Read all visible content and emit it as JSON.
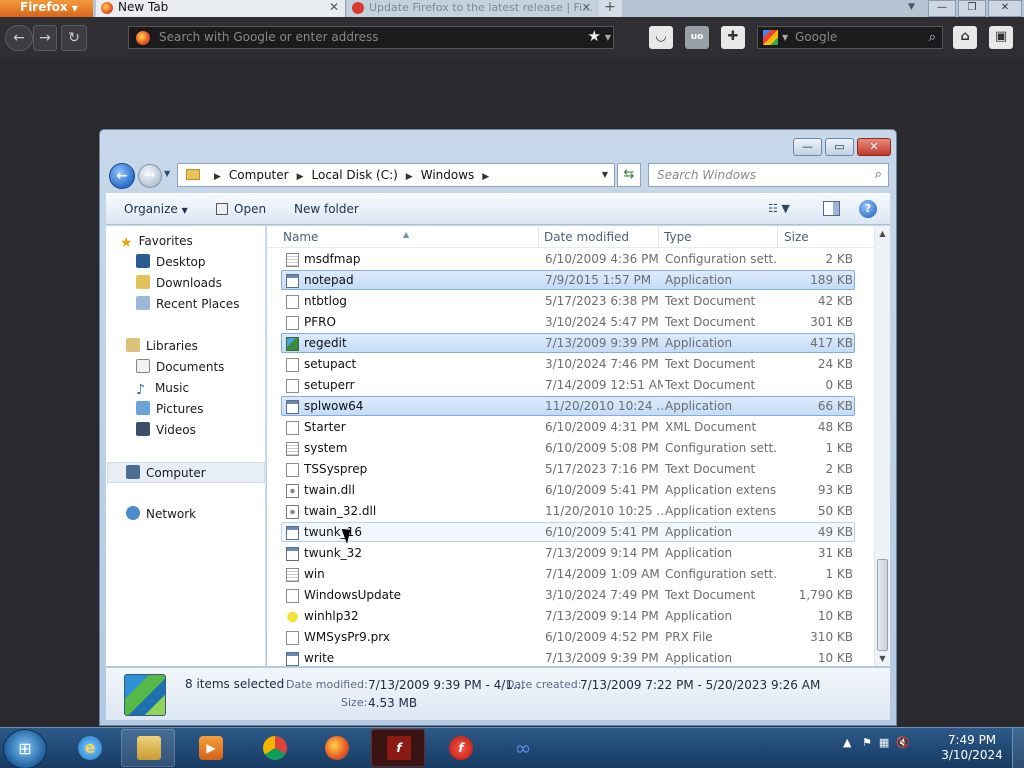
{
  "browser": {
    "menu_label": "Firefox",
    "tabs": [
      {
        "title": "New Tab"
      },
      {
        "title": "Update Firefox to the latest release | Fi..."
      }
    ],
    "new_tab_symbol": "+",
    "urlbar_placeholder": "Search with Google or enter address",
    "search_placeholder": "Google",
    "icons": [
      "back-icon",
      "forward-icon",
      "reload-icon",
      "bookmark-star-icon",
      "pocket-icon",
      "ublock-icon",
      "addon-icon",
      "google-icon",
      "home-icon",
      "sidebar-icon"
    ]
  },
  "explorer": {
    "breadcrumb": [
      "Computer",
      "Local Disk (C:)",
      "Windows"
    ],
    "search_placeholder": "Search Windows",
    "toolbar": {
      "organize": "Organize",
      "open": "Open",
      "new_folder": "New folder"
    },
    "nav": {
      "favorites": "Favorites",
      "favorites_items": [
        "Desktop",
        "Downloads",
        "Recent Places"
      ],
      "libraries": "Libraries",
      "libraries_items": [
        "Documents",
        "Music",
        "Pictures",
        "Videos"
      ],
      "computer": "Computer",
      "network": "Network"
    },
    "columns": {
      "name": "Name",
      "date": "Date modified",
      "type": "Type",
      "size": "Size"
    },
    "files": [
      {
        "name": "msdfmap",
        "date": "6/10/2009 4:36 PM",
        "type": "Configuration sett...",
        "size": "2 KB",
        "icon": "cfg",
        "state": ""
      },
      {
        "name": "notepad",
        "date": "7/9/2015 1:57 PM",
        "type": "Application",
        "size": "189 KB",
        "icon": "app",
        "state": "sel"
      },
      {
        "name": "ntbtlog",
        "date": "5/17/2023 6:38 PM",
        "type": "Text Document",
        "size": "42 KB",
        "icon": "doc",
        "state": ""
      },
      {
        "name": "PFRO",
        "date": "3/10/2024 5:47 PM",
        "type": "Text Document",
        "size": "301 KB",
        "icon": "doc",
        "state": ""
      },
      {
        "name": "regedit",
        "date": "7/13/2009 9:39 PM",
        "type": "Application",
        "size": "417 KB",
        "icon": "reg",
        "state": "sel"
      },
      {
        "name": "setupact",
        "date": "3/10/2024 7:46 PM",
        "type": "Text Document",
        "size": "24 KB",
        "icon": "doc",
        "state": ""
      },
      {
        "name": "setuperr",
        "date": "7/14/2009 12:51 AM",
        "type": "Text Document",
        "size": "0 KB",
        "icon": "doc",
        "state": ""
      },
      {
        "name": "splwow64",
        "date": "11/20/2010 10:24 ...",
        "type": "Application",
        "size": "66 KB",
        "icon": "app",
        "state": "sel"
      },
      {
        "name": "Starter",
        "date": "6/10/2009 4:31 PM",
        "type": "XML Document",
        "size": "48 KB",
        "icon": "doc",
        "state": ""
      },
      {
        "name": "system",
        "date": "6/10/2009 5:08 PM",
        "type": "Configuration sett...",
        "size": "1 KB",
        "icon": "cfg",
        "state": ""
      },
      {
        "name": "TSSysprep",
        "date": "5/17/2023 7:16 PM",
        "type": "Text Document",
        "size": "2 KB",
        "icon": "doc",
        "state": ""
      },
      {
        "name": "twain.dll",
        "date": "6/10/2009 5:41 PM",
        "type": "Application extens...",
        "size": "93 KB",
        "icon": "dll",
        "state": ""
      },
      {
        "name": "twain_32.dll",
        "date": "11/20/2010 10:25 ...",
        "type": "Application extens...",
        "size": "50 KB",
        "icon": "dll",
        "state": ""
      },
      {
        "name": "twunk_16",
        "date": "6/10/2009 5:41 PM",
        "type": "Application",
        "size": "49 KB",
        "icon": "app",
        "state": "hov"
      },
      {
        "name": "twunk_32",
        "date": "7/13/2009 9:14 PM",
        "type": "Application",
        "size": "31 KB",
        "icon": "app",
        "state": ""
      },
      {
        "name": "win",
        "date": "7/14/2009 1:09 AM",
        "type": "Configuration sett...",
        "size": "1 KB",
        "icon": "cfg",
        "state": ""
      },
      {
        "name": "WindowsUpdate",
        "date": "3/10/2024 7:49 PM",
        "type": "Text Document",
        "size": "1,790 KB",
        "icon": "doc",
        "state": ""
      },
      {
        "name": "winhlp32",
        "date": "7/13/2009 9:14 PM",
        "type": "Application",
        "size": "10 KB",
        "icon": "help",
        "state": ""
      },
      {
        "name": "WMSysPr9.prx",
        "date": "6/10/2009 4:52 PM",
        "type": "PRX File",
        "size": "310 KB",
        "icon": "doc",
        "state": ""
      },
      {
        "name": "write",
        "date": "7/13/2009 9:39 PM",
        "type": "Application",
        "size": "10 KB",
        "icon": "app",
        "state": ""
      }
    ],
    "details": {
      "selected_count": "8 items selected",
      "date_modified_label": "Date modified:",
      "date_modified_value": "7/13/2009 9:39 PM - 4/1...",
      "date_created_label": "Date created:",
      "date_created_value": "7/13/2009 7:22 PM - 5/20/2023 9:26 AM",
      "size_label": "Size:",
      "size_value": "4.53 MB"
    }
  },
  "taskbar": {
    "apps": [
      "internet-explorer-icon",
      "file-explorer-icon",
      "media-player-icon",
      "chrome-icon",
      "firefox-icon",
      "flash-icon",
      "flash-player-icon",
      "infinity-icon"
    ],
    "clock_time": "7:49 PM",
    "clock_date": "3/10/2024"
  }
}
